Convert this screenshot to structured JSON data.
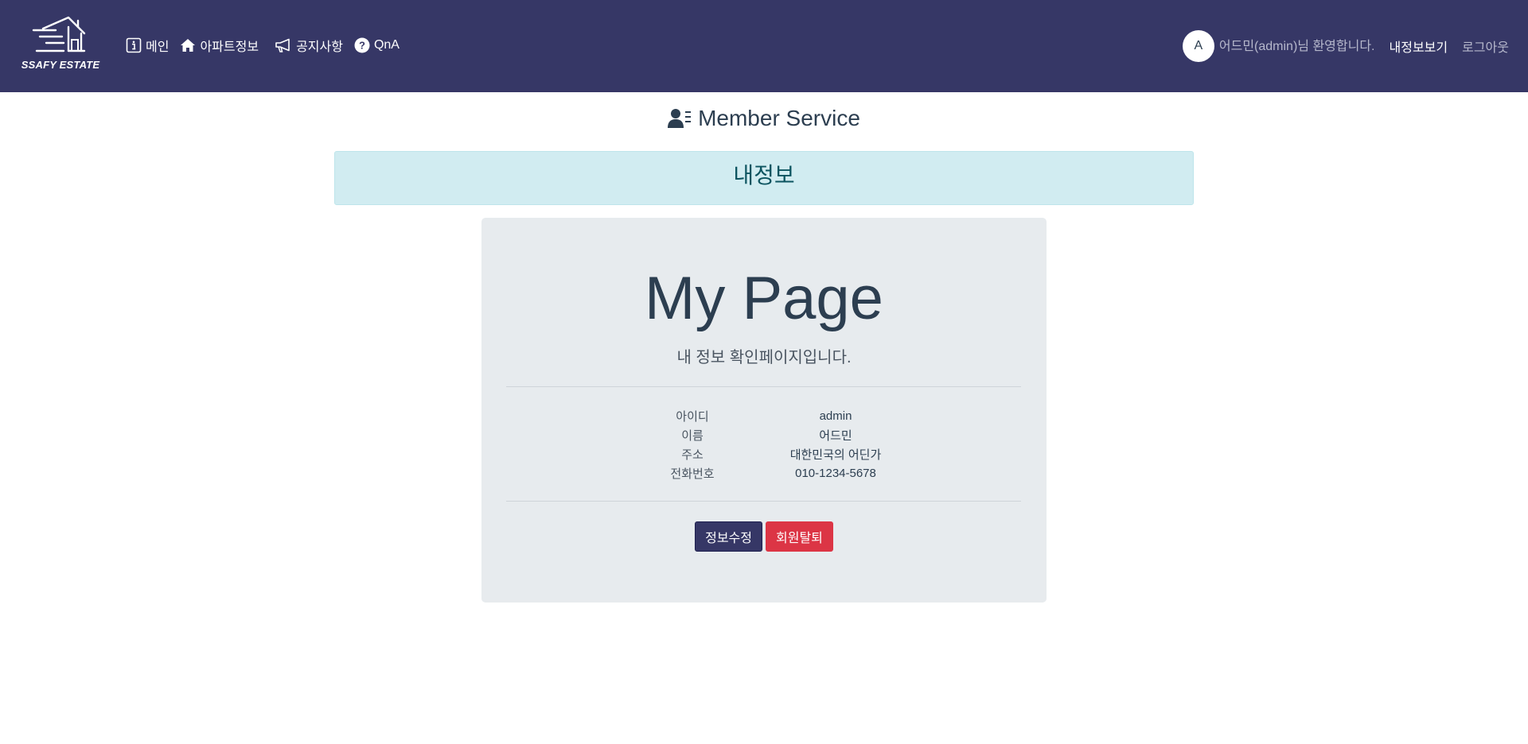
{
  "navbar": {
    "brand_text": "SSAFY ESTATE",
    "bg_color": "#363766",
    "links": [
      {
        "label": "메인",
        "icon": "info-box-icon"
      },
      {
        "label": "아파트정보",
        "icon": "home-icon"
      },
      {
        "label": "공지사항",
        "icon": "megaphone-icon"
      },
      {
        "label": "QnA",
        "icon": "question-circle-icon"
      }
    ],
    "avatar_letter": "A",
    "welcome_text": "어드민(admin)님 환영합니다.",
    "mypage_label": "내정보보기",
    "logout_label": "로그아웃"
  },
  "section": {
    "title": "Member Service",
    "icon": "user-list-icon"
  },
  "alert": {
    "text": "내정보",
    "bg_color": "#d1ecf1"
  },
  "jumbotron": {
    "title": "My Page",
    "subtitle": "내 정보 확인페이지입니다.",
    "rows": [
      {
        "label": "아이디",
        "value": "admin"
      },
      {
        "label": "이름",
        "value": "어드민"
      },
      {
        "label": "주소",
        "value": "대한민국의 어딘가"
      },
      {
        "label": "전화번호",
        "value": "010-1234-5678"
      }
    ],
    "edit_button": "정보수정",
    "withdraw_button": "회원탈퇴",
    "edit_color": "#363766",
    "withdraw_color": "#dc3545"
  }
}
